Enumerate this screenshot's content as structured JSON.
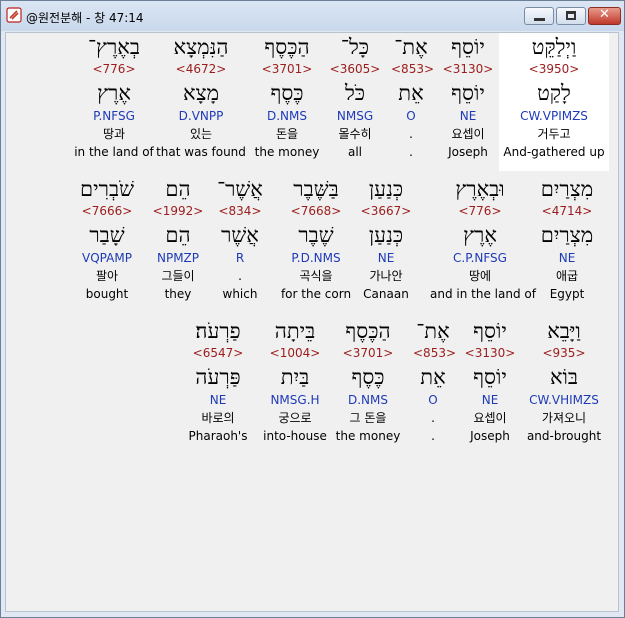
{
  "window": {
    "title": "@원전분해 - 창 47:14",
    "controls": {
      "minimize": "minimize",
      "maximize": "maximize",
      "close": "✕"
    }
  },
  "rows": [
    {
      "words": [
        {
          "hebrew": "וַיְלַקֵּט",
          "strong": "<3950>",
          "root": "לָקַט",
          "parse": "CW.VPIMZS",
          "korean": "거두고",
          "english": "And-gathered up",
          "selected": true
        },
        {
          "hebrew": "יוֹסֵף",
          "strong": "<3130>",
          "root": "יוֹסֵף",
          "parse": "NE",
          "korean": "요셉이",
          "english": "Joseph"
        },
        {
          "hebrew": "אֶת־",
          "strong": "<853>",
          "root": "אֵת",
          "parse": "O",
          "korean": ".",
          "english": "."
        },
        {
          "hebrew": "כָּל־",
          "strong": "<3605>",
          "root": "כֹּל",
          "parse": "NMSG",
          "korean": "몰수히",
          "english": "all"
        },
        {
          "hebrew": "הַכֶּסֶף",
          "strong": "<3701>",
          "root": "כֶּסֶף",
          "parse": "D.NMS",
          "korean": "돈을",
          "english": "the money"
        },
        {
          "hebrew": "הַנִּמְצָא",
          "strong": "<4672>",
          "root": "מָצָא",
          "parse": "D.VNPP",
          "korean": "있는",
          "english": "that was found"
        },
        {
          "hebrew": "בְאֶרֶץ־",
          "strong": "<776>",
          "root": "אֶרֶץ",
          "parse": "P.NFSG",
          "korean": "땅과",
          "english": "in the land of"
        }
      ]
    },
    {
      "words": [
        {
          "hebrew": "מִצְרַיִם",
          "strong": "<4714>",
          "root": "מִצְרַיִם",
          "parse": "NE",
          "korean": "애굽",
          "english": "Egypt"
        },
        {
          "hebrew": "וּבְאֶרֶץ",
          "strong": "<776>",
          "root": "אֶרֶץ",
          "parse": "C.P.NFSG",
          "korean": "땅에",
          "english": "and in the land of"
        },
        {
          "hebrew": "כְּנַעַן",
          "strong": "<3667>",
          "root": "כְּנַעַן",
          "parse": "NE",
          "korean": "가나안",
          "english": "Canaan"
        },
        {
          "hebrew": "בַּשֶּׁבֶר",
          "strong": "<7668>",
          "root": "שֶׁבֶר",
          "parse": "P.D.NMS",
          "korean": "곡식을",
          "english": "for the corn"
        },
        {
          "hebrew": "אֲשֶׁר־",
          "strong": "<834>",
          "root": "אֲשֶׁר",
          "parse": "R",
          "korean": ".",
          "english": "which"
        },
        {
          "hebrew": "הֵם",
          "strong": "<1992>",
          "root": "הֵם",
          "parse": "NPMZP",
          "korean": "그들이",
          "english": "they"
        },
        {
          "hebrew": "שֹׁבְרִים",
          "strong": "<7666>",
          "root": "שָׁבַר",
          "parse": "VQPAMP",
          "korean": "팔아",
          "english": "bought"
        }
      ]
    },
    {
      "words": [
        {
          "hebrew": "וַיָּבֵא",
          "strong": "<935>",
          "root": "בּוֹא",
          "parse": "CW.VHIMZS",
          "korean": "가져오니",
          "english": "and-brought"
        },
        {
          "hebrew": "יוֹסֵף",
          "strong": "<3130>",
          "root": "יוֹסֵף",
          "parse": "NE",
          "korean": "요셉이",
          "english": "Joseph"
        },
        {
          "hebrew": "אֶת־",
          "strong": "<853>",
          "root": "אֵת",
          "parse": "O",
          "korean": ".",
          "english": "."
        },
        {
          "hebrew": "הַכֶּסֶף",
          "strong": "<3701>",
          "root": "כֶּסֶף",
          "parse": "D.NMS",
          "korean": "그 돈을",
          "english": "the money"
        },
        {
          "hebrew": "בֵּיתָה",
          "strong": "<1004>",
          "root": "בַּיִת",
          "parse": "NMSG.H",
          "korean": "궁으로",
          "english": "into-house"
        },
        {
          "hebrew": "פַרְעֹה׃",
          "strong": "<6547>",
          "root": "פַּרְעֹה",
          "parse": "NE",
          "korean": "바로의",
          "english": "Pharaoh's"
        }
      ]
    }
  ]
}
